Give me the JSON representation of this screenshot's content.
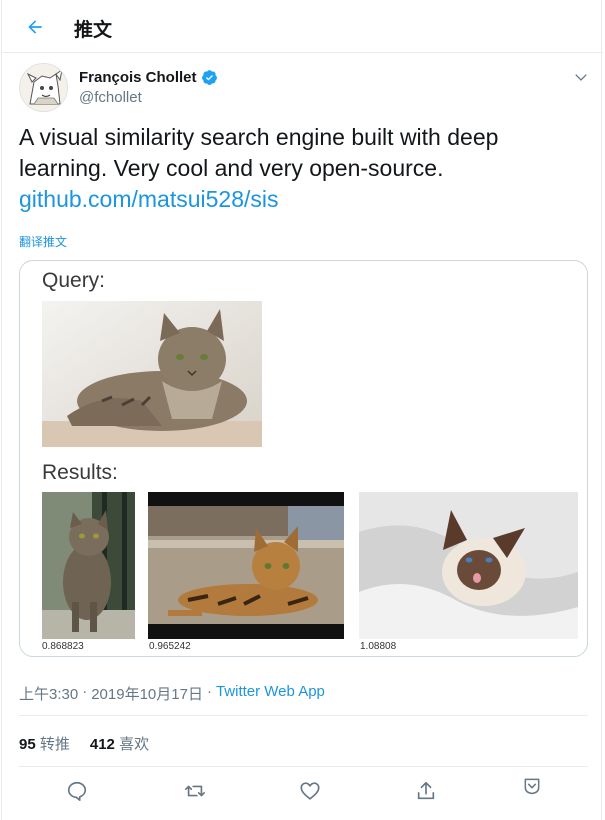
{
  "header": {
    "title": "推文"
  },
  "tweet": {
    "author_name": "François Chollet",
    "handle": "@fchollet",
    "text_line1": "A visual similarity search engine built with deep",
    "text_line2": "learning. Very cool and very open-source.",
    "link": "github.com/matsui528/sis",
    "translate_label": "翻译推文",
    "media": {
      "query_label": "Query:",
      "results_label": "Results:",
      "scores": [
        "0.868823",
        "0.965242",
        "1.08808"
      ]
    },
    "time": "上午3:30",
    "sep": "·",
    "date": "2019年10月17日",
    "sep2": "·",
    "app": "Twitter Web App",
    "retweets": {
      "count": "95",
      "label": "转推"
    },
    "likes": {
      "count": "412",
      "label": "喜欢"
    }
  },
  "icons": {
    "back": "arrow-left-icon",
    "verified": "verified-badge-icon",
    "caret": "chevron-down-icon",
    "reply": "reply-icon",
    "retweet": "retweet-icon",
    "like": "heart-icon",
    "share": "share-icon",
    "bookmark": "bookmark-icon"
  },
  "colors": {
    "accent": "#1da1f2",
    "link": "#1b95e0",
    "secondary_text": "#657786",
    "border": "#e6ecf0"
  }
}
